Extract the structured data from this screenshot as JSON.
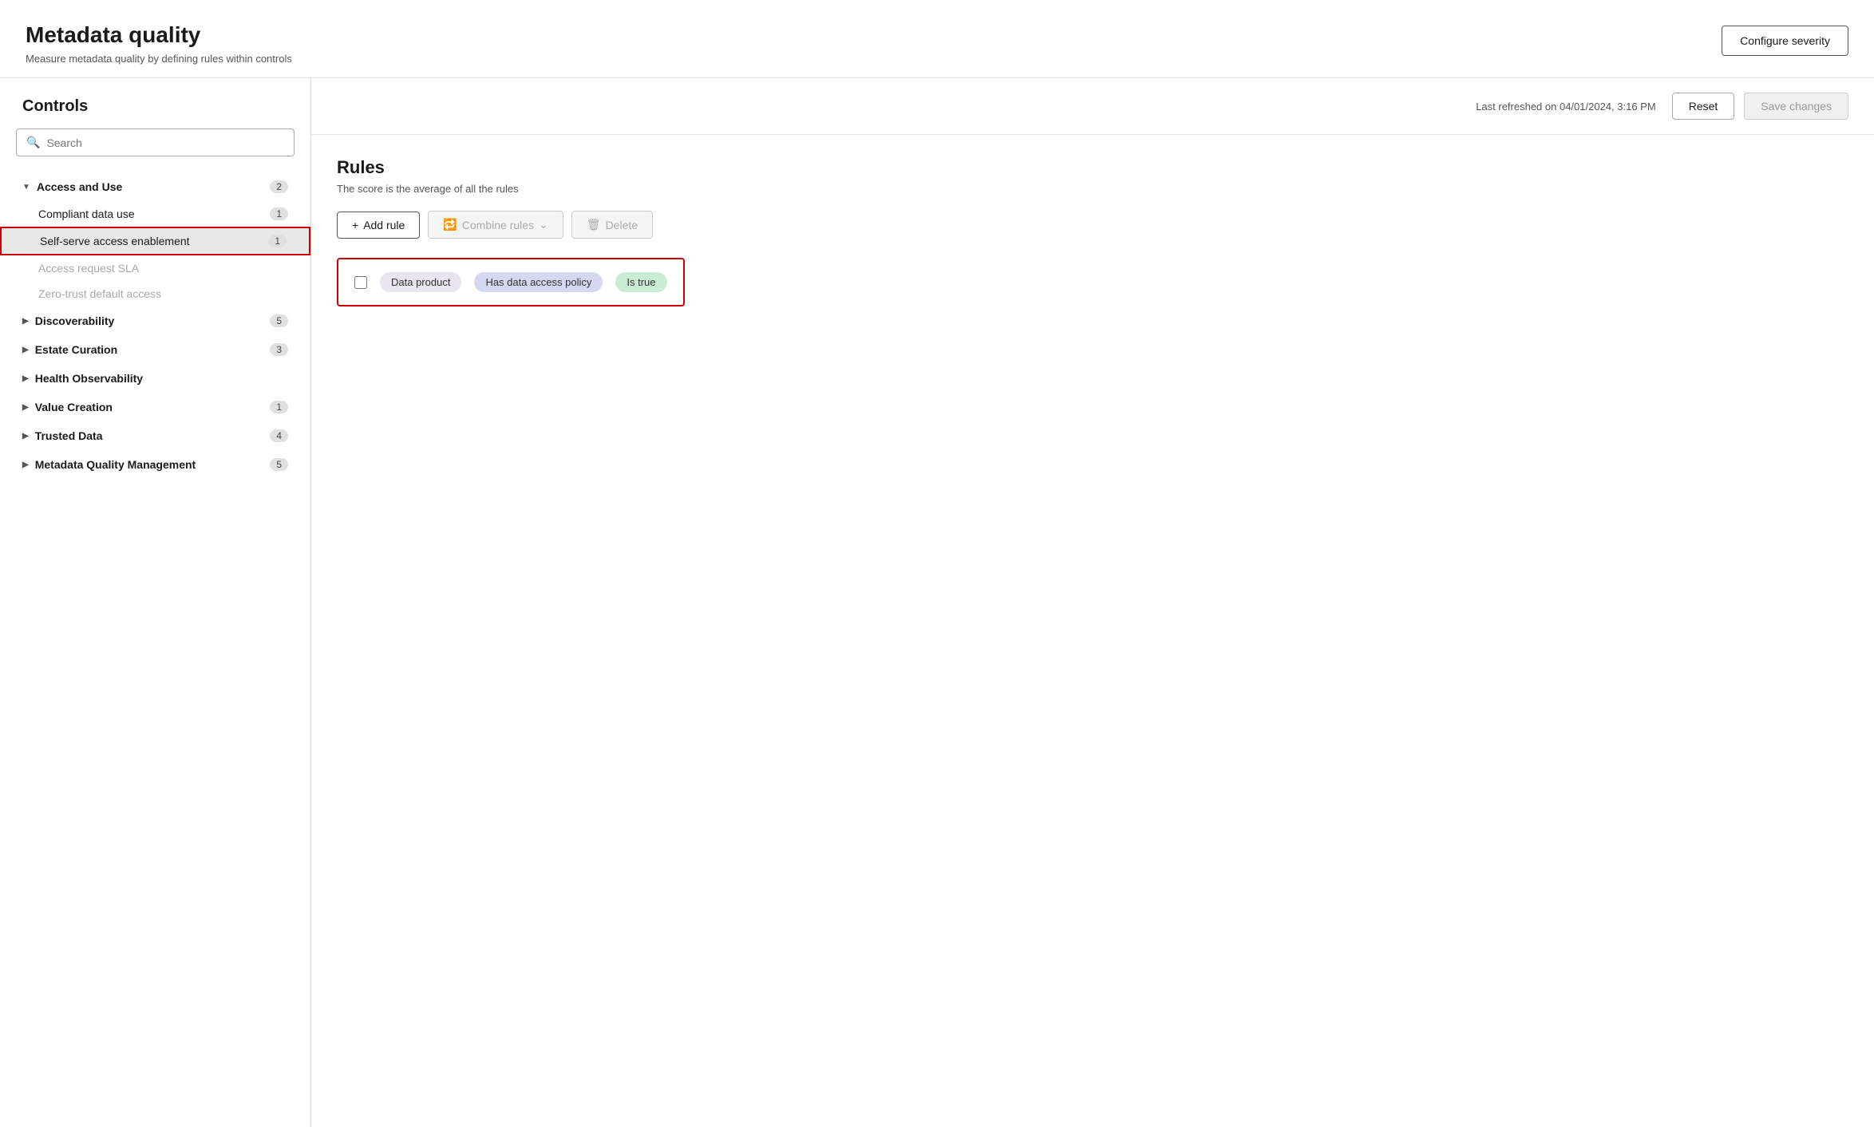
{
  "header": {
    "title": "Metadata quality",
    "subtitle": "Measure metadata quality by defining rules within controls",
    "configure_severity_label": "Configure severity"
  },
  "sidebar": {
    "heading": "Controls",
    "search_placeholder": "Search",
    "groups": [
      {
        "id": "access-and-use",
        "label": "Access and Use",
        "badge": "2",
        "expanded": true,
        "items": [
          {
            "id": "compliant-data-use",
            "label": "Compliant data use",
            "badge": "1",
            "active": false,
            "disabled": false
          },
          {
            "id": "self-serve-access-enablement",
            "label": "Self-serve access enablement",
            "badge": "1",
            "active": true,
            "disabled": false
          },
          {
            "id": "access-request-sla",
            "label": "Access request SLA",
            "badge": "",
            "active": false,
            "disabled": true
          },
          {
            "id": "zero-trust-default-access",
            "label": "Zero-trust default access",
            "badge": "",
            "active": false,
            "disabled": true
          }
        ]
      },
      {
        "id": "discoverability",
        "label": "Discoverability",
        "badge": "5",
        "expanded": false,
        "items": []
      },
      {
        "id": "estate-curation",
        "label": "Estate Curation",
        "badge": "3",
        "expanded": false,
        "items": []
      },
      {
        "id": "health-observability",
        "label": "Health Observability",
        "badge": "",
        "expanded": false,
        "items": []
      },
      {
        "id": "value-creation",
        "label": "Value Creation",
        "badge": "1",
        "expanded": false,
        "items": []
      },
      {
        "id": "trusted-data",
        "label": "Trusted Data",
        "badge": "4",
        "expanded": false,
        "items": []
      },
      {
        "id": "metadata-quality-management",
        "label": "Metadata Quality Management",
        "badge": "5",
        "expanded": false,
        "items": []
      }
    ]
  },
  "toolbar": {
    "last_refreshed_label": "Last refreshed on 04/01/2024, 3:16 PM",
    "reset_label": "Reset",
    "save_changes_label": "Save changes"
  },
  "rules": {
    "title": "Rules",
    "subtitle": "The score is the average of all the rules",
    "add_rule_label": "Add rule",
    "combine_rules_label": "Combine rules",
    "delete_label": "Delete",
    "rule_rows": [
      {
        "entity": "Data product",
        "attribute": "Has data access policy",
        "value": "Is true"
      }
    ]
  }
}
